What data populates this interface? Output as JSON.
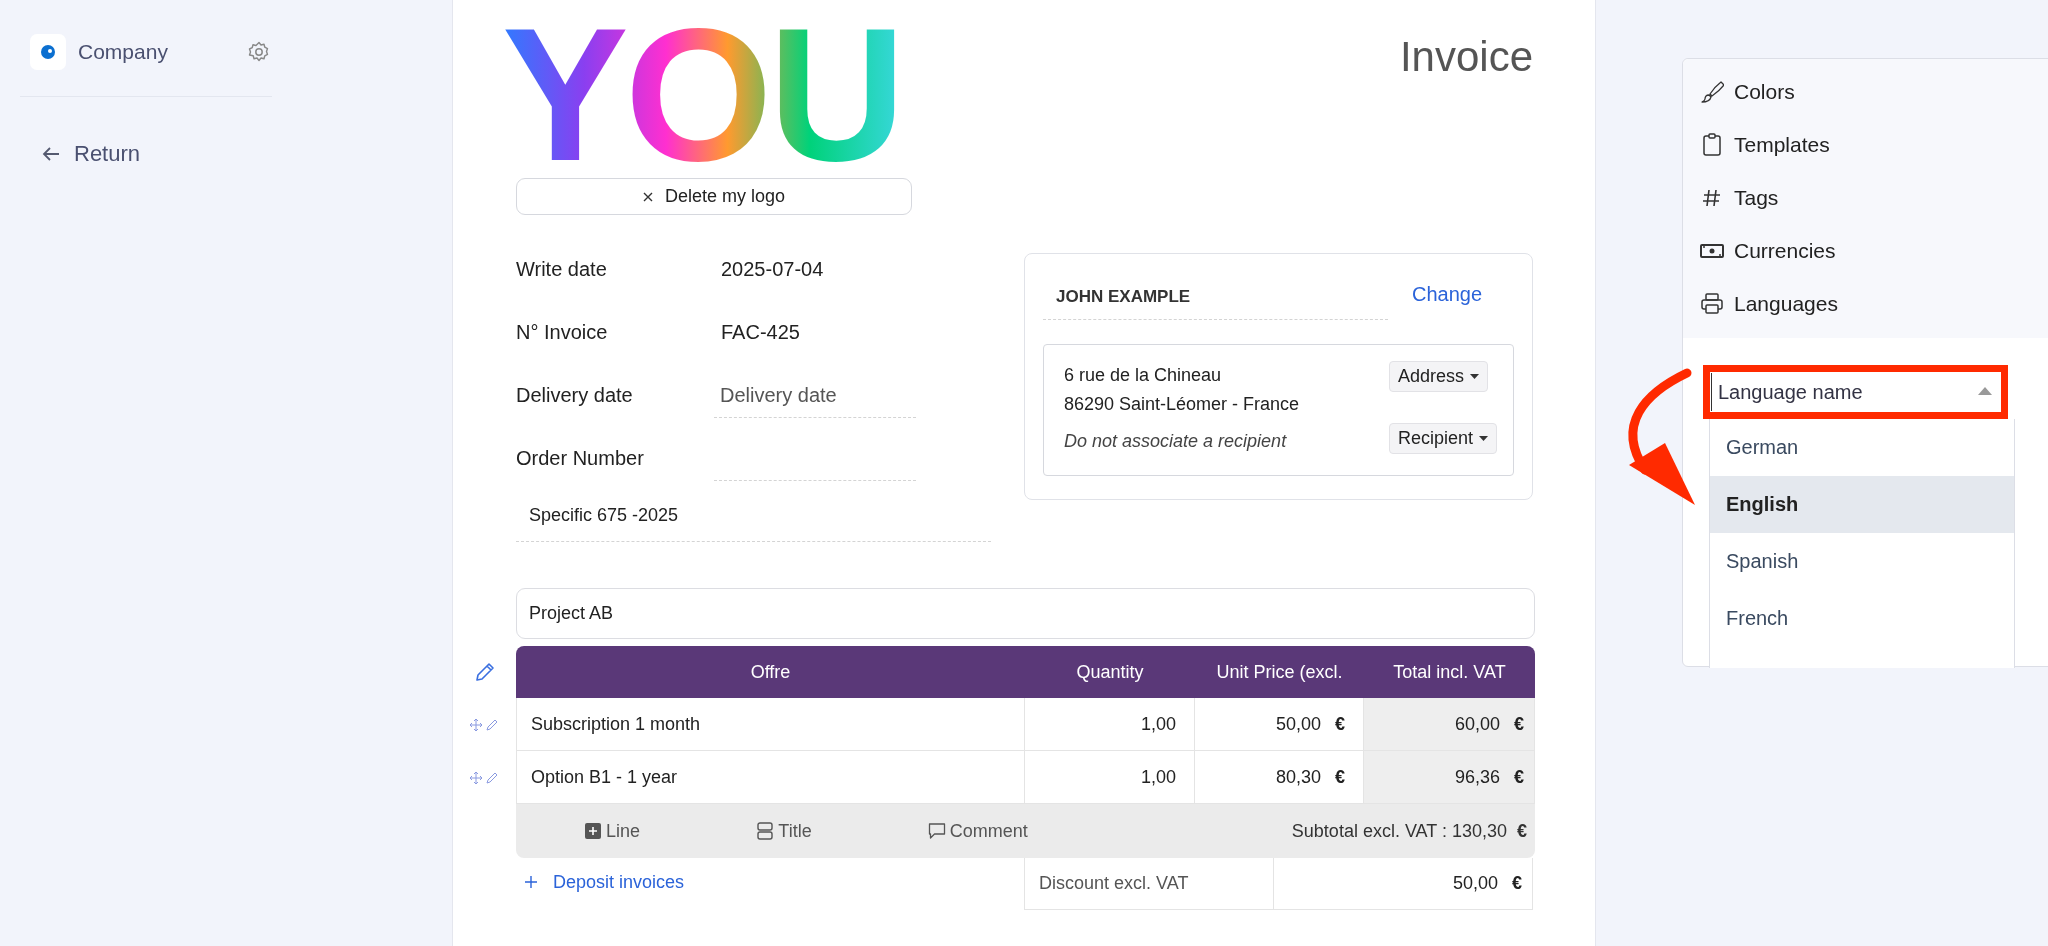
{
  "sidebar": {
    "company": "Company",
    "return": "Return"
  },
  "invoice": {
    "logo_text": "YOU",
    "delete_logo": "Delete my logo",
    "title": "Invoice",
    "fields": [
      {
        "label": "Write date",
        "value": "2025-07-04"
      },
      {
        "label": "N° Invoice",
        "value": "FAC-425"
      },
      {
        "label": "Delivery date",
        "placeholder": "Delivery date"
      },
      {
        "label": "Order Number"
      }
    ],
    "reference": "Specific 675 -2025",
    "client": {
      "name": "JOHN EXAMPLE",
      "change": "Change",
      "address_lines": [
        "6 rue de la Chineau",
        "86290 Saint-Léomer - France"
      ],
      "recipient_note": "Do not associate a recipient",
      "address_button": "Address",
      "recipient_button": "Recipient"
    },
    "project": "Project AB",
    "table": {
      "columns": [
        "Offre",
        "Quantity",
        "Unit Price (excl.",
        "Total incl. VAT"
      ],
      "rows": [
        {
          "offer": "Subscription 1 month",
          "quantity": "1,00",
          "unit_price": "50,00",
          "unit_currency": "€",
          "total": "60,00",
          "total_currency": "€"
        },
        {
          "offer": "Option B1 - 1 year",
          "quantity": "1,00",
          "unit_price": "80,30",
          "unit_currency": "€",
          "total": "96,36",
          "total_currency": "€"
        }
      ],
      "actions": [
        {
          "label": "Line",
          "kind": "line"
        },
        {
          "label": "Title",
          "kind": "title"
        },
        {
          "label": "Comment",
          "kind": "comment"
        }
      ],
      "subtotal": "Subtotal excl. VAT : 130,30",
      "subtotal_currency": "€"
    },
    "deposit": "Deposit invoices",
    "discount": {
      "label": "Discount excl. VAT",
      "value": "50,00",
      "currency": "€"
    }
  },
  "settings_menu": {
    "items": [
      {
        "label": "Colors",
        "kind": "brush"
      },
      {
        "label": "Templates",
        "kind": "clipboard"
      },
      {
        "label": "Tags",
        "kind": "hash"
      },
      {
        "label": "Currencies",
        "kind": "banknote"
      },
      {
        "label": "Languages",
        "kind": "printer"
      }
    ],
    "language_select": {
      "placeholder": "Language name",
      "expanded": true,
      "options": [
        {
          "label": "German",
          "selected": false
        },
        {
          "label": "English",
          "selected": true
        },
        {
          "label": "Spanish",
          "selected": false
        },
        {
          "label": "French",
          "selected": false
        }
      ]
    }
  }
}
